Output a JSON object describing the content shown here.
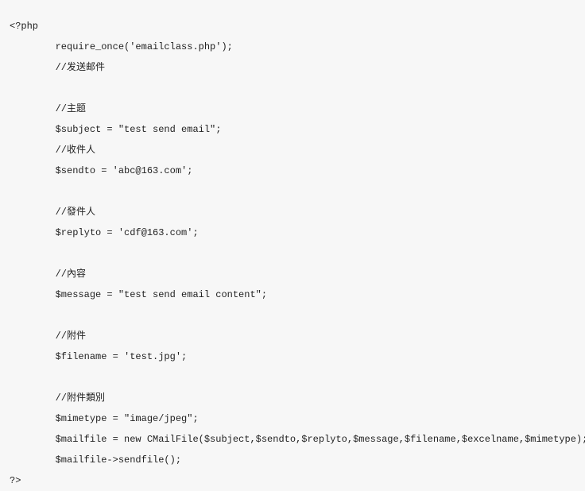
{
  "code": {
    "lines": [
      "<?php",
      "        require_once('emailclass.php');",
      "        //发送邮件",
      "",
      "        //主题",
      "        $subject = \"test send email\";",
      "        //收件人",
      "        $sendto = 'abc@163.com';",
      "",
      "        //發件人",
      "        $replyto = 'cdf@163.com';",
      "",
      "        //內容",
      "        $message = \"test send email content\";",
      "",
      "        //附件",
      "        $filename = 'test.jpg';",
      "",
      "        //附件類別",
      "        $mimetype = \"image/jpeg\";",
      "        $mailfile = new CMailFile($subject,$sendto,$replyto,$message,$filename,$excelname,$mimetype);",
      "        $mailfile->sendfile();",
      "?>"
    ]
  }
}
